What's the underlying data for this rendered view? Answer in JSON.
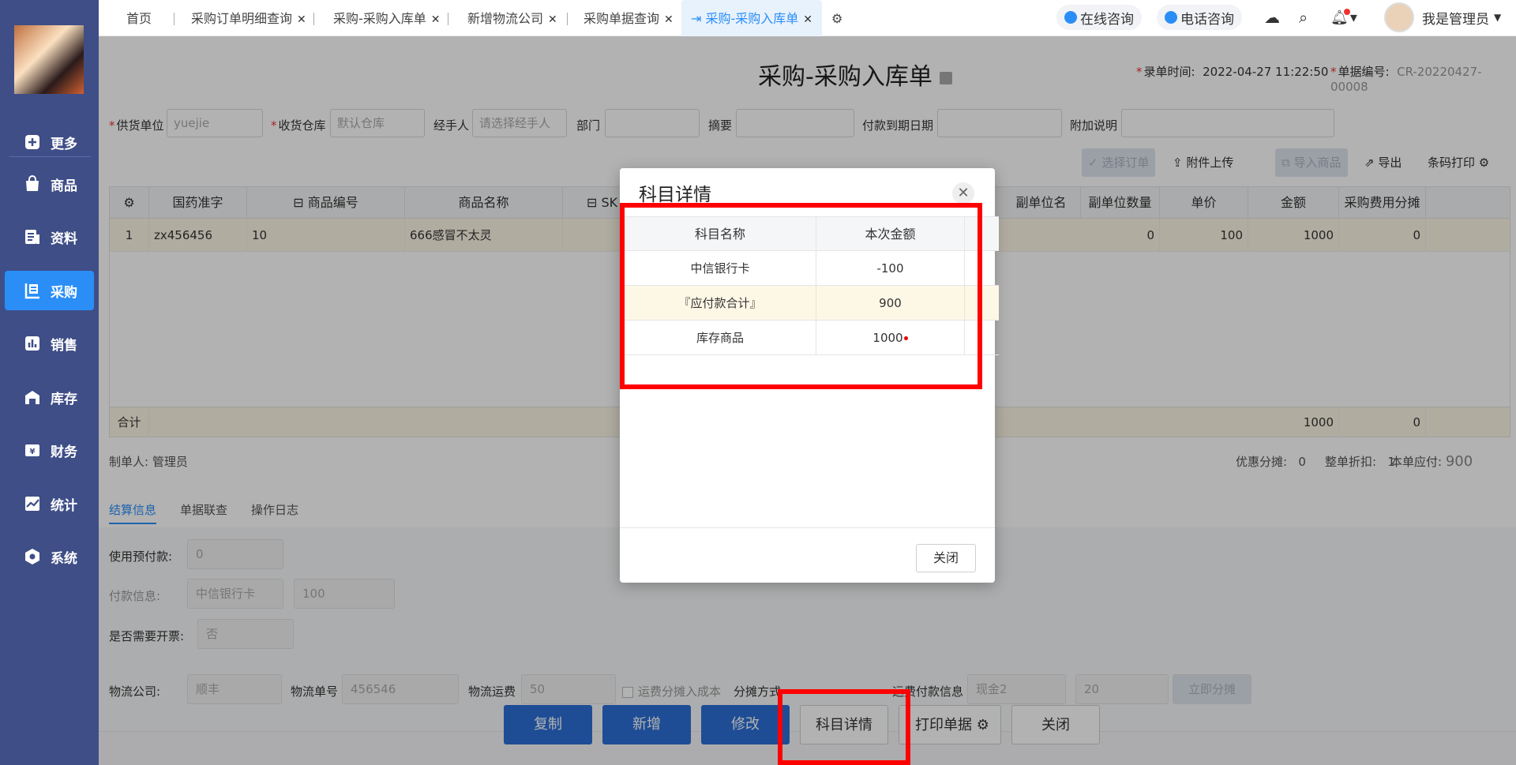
{
  "sidebar": {
    "items": [
      {
        "label": "更多",
        "icon": "plus-square-icon"
      },
      {
        "label": "商品",
        "icon": "bag-icon"
      },
      {
        "label": "资料",
        "icon": "document-icon"
      },
      {
        "label": "采购",
        "icon": "purchase-icon"
      },
      {
        "label": "销售",
        "icon": "bar-chart-icon"
      },
      {
        "label": "库存",
        "icon": "warehouse-icon"
      },
      {
        "label": "财务",
        "icon": "yen-icon"
      },
      {
        "label": "统计",
        "icon": "trend-icon"
      },
      {
        "label": "系统",
        "icon": "hexagon-icon"
      }
    ]
  },
  "tabs": [
    {
      "label": "首页"
    },
    {
      "label": "采购订单明细查询"
    },
    {
      "label": "采购-采购入库单"
    },
    {
      "label": "新增物流公司"
    },
    {
      "label": "采购单据查询"
    },
    {
      "label": "采购-采购入库单"
    }
  ],
  "topbar": {
    "online": "在线咨询",
    "phone": "电话咨询",
    "user": "我是管理员"
  },
  "page": {
    "title": "采购-采购入库单",
    "record_time_label": "录单时间:",
    "record_time": "2022-04-27 11:22:50",
    "doc_no_label": "单据编号:",
    "doc_no": "CR-20220427-00008"
  },
  "form": {
    "supplier_label": "供货单位",
    "supplier_value": "yuejie",
    "warehouse_label": "收货仓库",
    "warehouse_value": "默认仓库",
    "handler_label": "经手人",
    "handler_placeholder": "请选择经手人",
    "dept_label": "部门",
    "summary_label": "摘要",
    "due_label": "付款到期日期",
    "extra_label": "附加说明"
  },
  "toolbar": {
    "select_order": "选择订单",
    "attach": "附件上传",
    "import": "导入商品",
    "export": "导出",
    "barcode": "条码打印"
  },
  "grid": {
    "headers": [
      "国药准字",
      "商品编号",
      "商品名称",
      "SK",
      "副单位名",
      "副单位数量",
      "单价",
      "金额",
      "采购费用分摊"
    ],
    "row": {
      "idx": "1",
      "gyzz": "zx456456",
      "code": "10",
      "name": "666感冒不太灵",
      "sub_qty": "0",
      "price": "100",
      "amount": "1000",
      "fee": "0"
    },
    "footer": {
      "label": "合计",
      "amount": "1000",
      "fee": "0"
    }
  },
  "summary": {
    "maker_label": "制单人:",
    "maker": "管理员",
    "discount_label": "优惠分摊:",
    "discount": "0",
    "rate_label": "整单折扣:",
    "rate": "1",
    "payable_label": "本单应付:",
    "payable": "900"
  },
  "subtabs": [
    "结算信息",
    "单据联查",
    "操作日志"
  ],
  "settle": {
    "prepay_label": "使用预付款:",
    "prepay": "0",
    "payinfo_label": "付款信息:",
    "pay_account": "中信银行卡",
    "pay_amount": "100",
    "invoice_label": "是否需要开票:",
    "invoice": "否",
    "logistics_label": "物流公司:",
    "logistics": "顺丰",
    "tracking_label": "物流单号",
    "tracking": "456546",
    "freight_label": "物流运费",
    "freight": "50",
    "freight_cost_label": "运费分摊入成本",
    "split_label": "分摊方式",
    "freight_pay_label": "运费付款信息",
    "freight_pay_account": "现金2",
    "freight_pay_amount": "20",
    "split_btn": "立即分摊"
  },
  "footer": {
    "copy": "复制",
    "add": "新增",
    "edit": "修改",
    "detail": "科目详情",
    "print": "打印单据",
    "close": "关闭"
  },
  "modal": {
    "title": "科目详情",
    "columns": [
      "科目名称",
      "本次金额"
    ],
    "rows": [
      {
        "name": "中信银行卡",
        "amount": "-100"
      },
      {
        "name": "『应付款合计』",
        "amount": "900"
      },
      {
        "name": "库存商品",
        "amount": "1000"
      }
    ],
    "close": "关闭"
  },
  "colors": {
    "sidebar": "#3f4e87",
    "accent": "#2b8ef7",
    "primary_button": "#2b6fd6",
    "highlight": "#ff0000"
  }
}
